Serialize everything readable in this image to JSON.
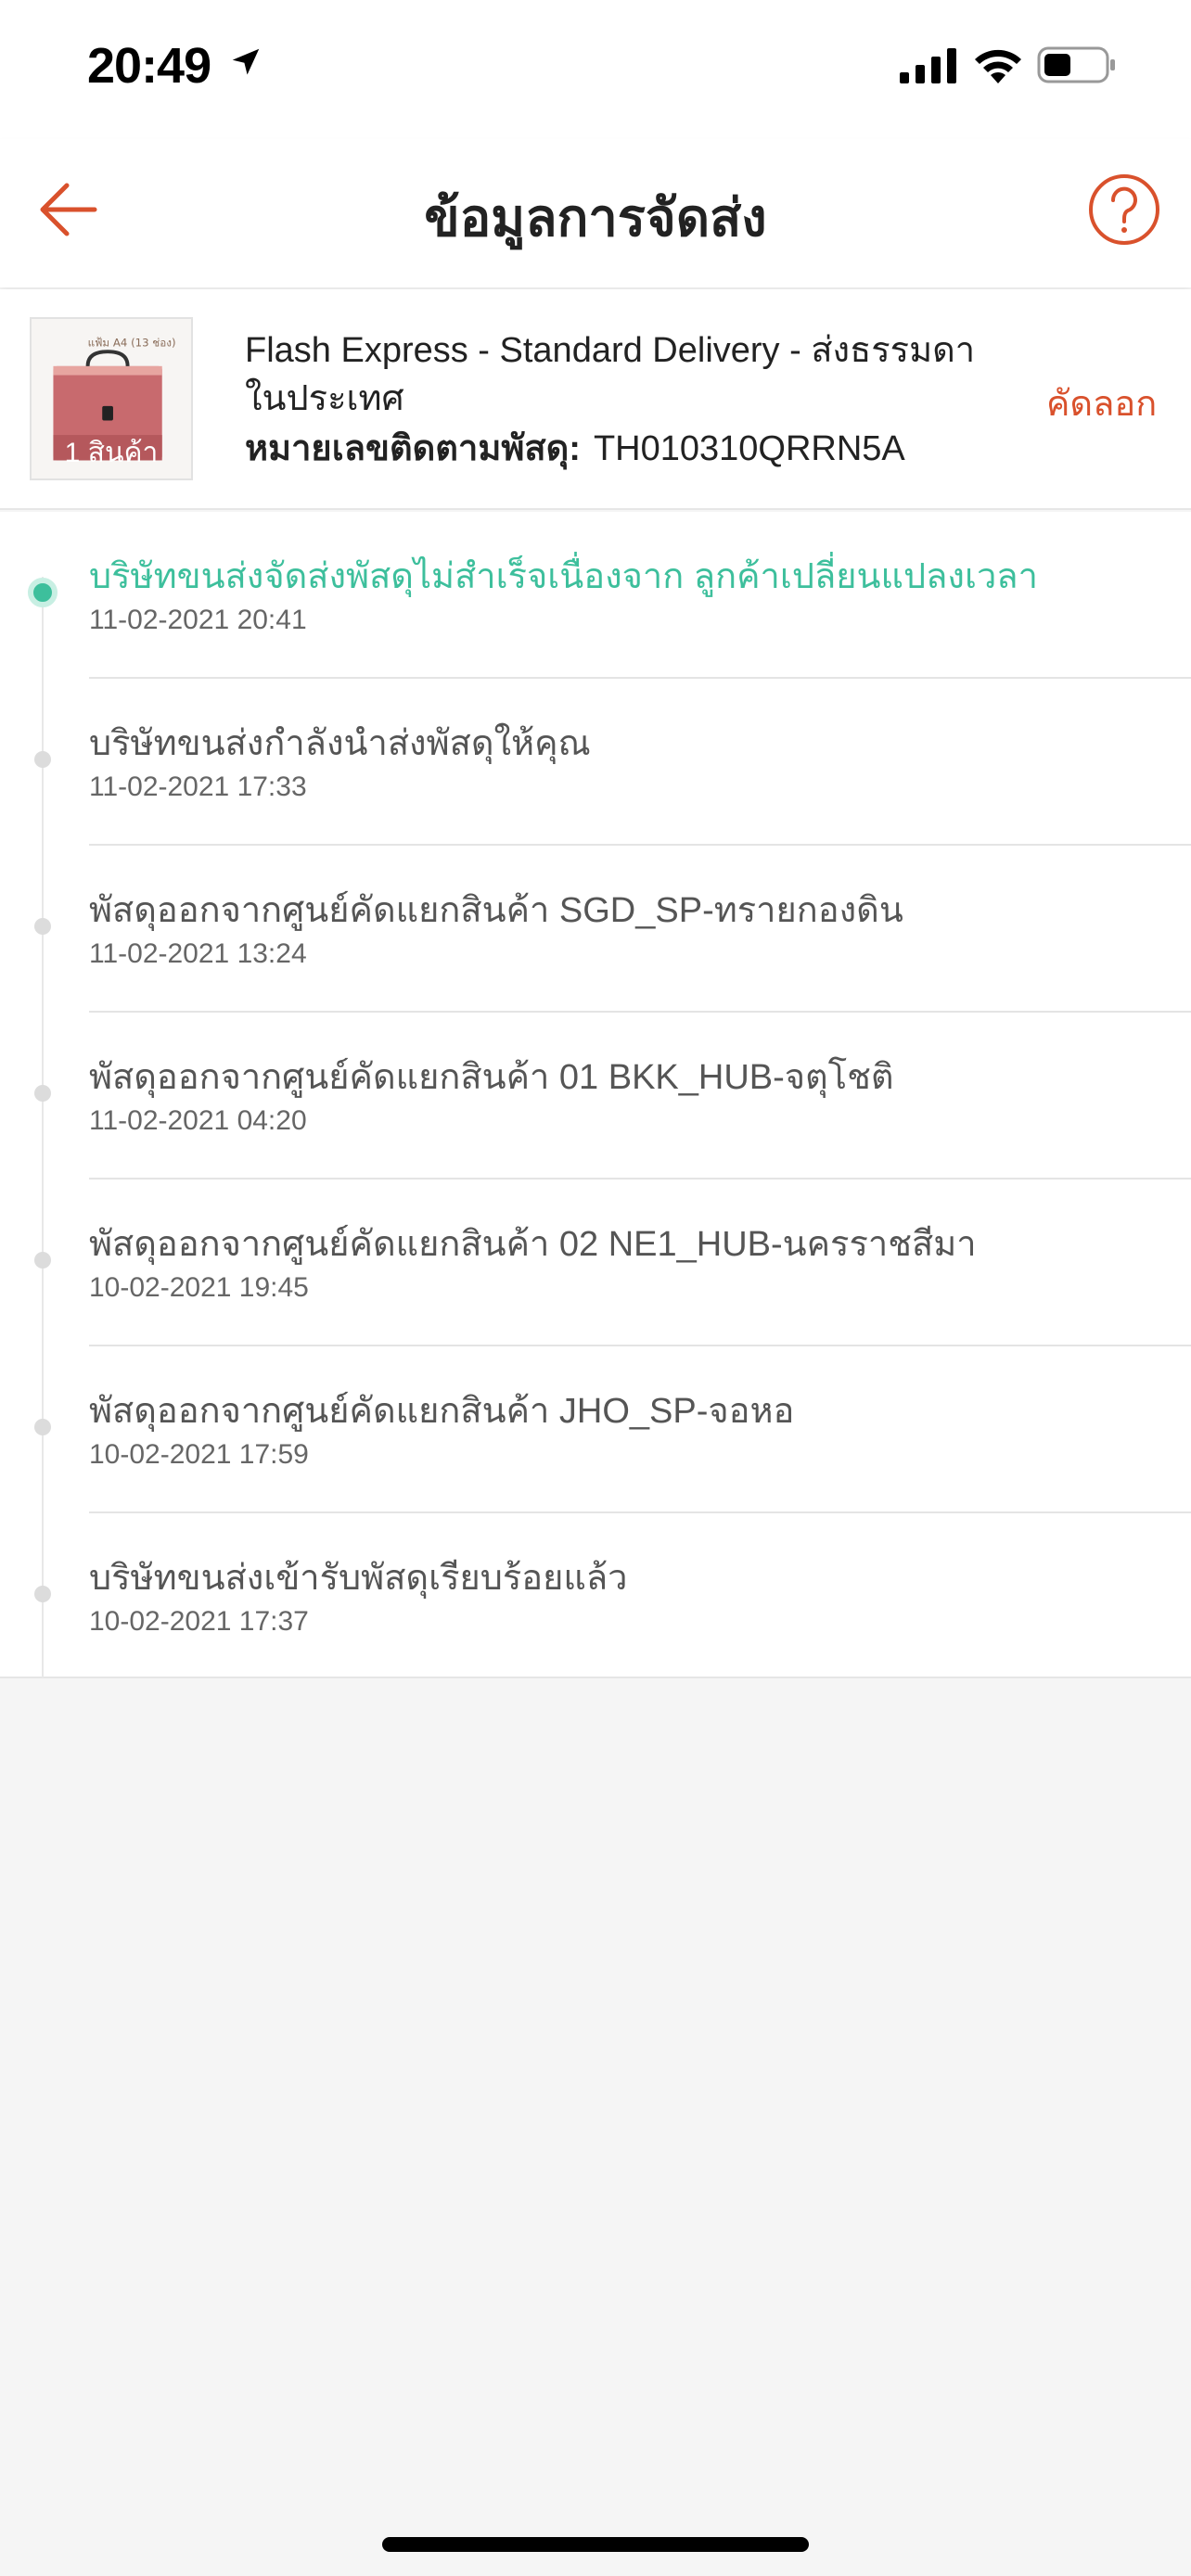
{
  "status_bar": {
    "time": "20:49"
  },
  "header": {
    "title": "ข้อมูลการจัดส่ง"
  },
  "product": {
    "thumbnail_caption": "1 สินค้า",
    "thumbnail_label": "แฟ้ม A4 (13 ช่อง)",
    "carrier_line1": "Flash Express - Standard Delivery - ส่งธรรมดา",
    "carrier_line2": "ในประเทศ",
    "tracking_label": "หมายเลขติดตามพัสดุ:",
    "tracking_number": "TH010310QRRN5A",
    "copy_label": "คัดลอก"
  },
  "timeline": [
    {
      "title": "บริษัทขนส่งจัดส่งพัสดุไม่สำเร็จเนื่องจาก ลูกค้าเปลี่ยนแปลงเวลา",
      "time": "11-02-2021 20:41",
      "active": true
    },
    {
      "title": "บริษัทขนส่งกำลังนำส่งพัสดุให้คุณ",
      "time": "11-02-2021 17:33",
      "active": false
    },
    {
      "title": "พัสดุออกจากศูนย์คัดแยกสินค้า SGD_SP-ทรายกองดิน",
      "time": "11-02-2021 13:24",
      "active": false
    },
    {
      "title": "พัสดุออกจากศูนย์คัดแยกสินค้า 01 BKK_HUB-จตุโชติ",
      "time": "11-02-2021 04:20",
      "active": false
    },
    {
      "title": "พัสดุออกจากศูนย์คัดแยกสินค้า 02 NE1_HUB-นครราชสีมา",
      "time": "10-02-2021 19:45",
      "active": false
    },
    {
      "title": "พัสดุออกจากศูนย์คัดแยกสินค้า JHO_SP-จอหอ",
      "time": "10-02-2021 17:59",
      "active": false
    },
    {
      "title": "บริษัทขนส่งเข้ารับพัสดุเรียบร้อยแล้ว",
      "time": "10-02-2021 17:37",
      "active": false
    }
  ],
  "colors": {
    "accent": "#d9512c",
    "active_status": "#3dbf9c"
  },
  "icons": {
    "back": "arrow-left-icon",
    "help": "question-circle-icon",
    "location": "location-arrow-icon",
    "signal": "cellular-signal-icon",
    "wifi": "wifi-icon",
    "battery": "battery-icon"
  }
}
